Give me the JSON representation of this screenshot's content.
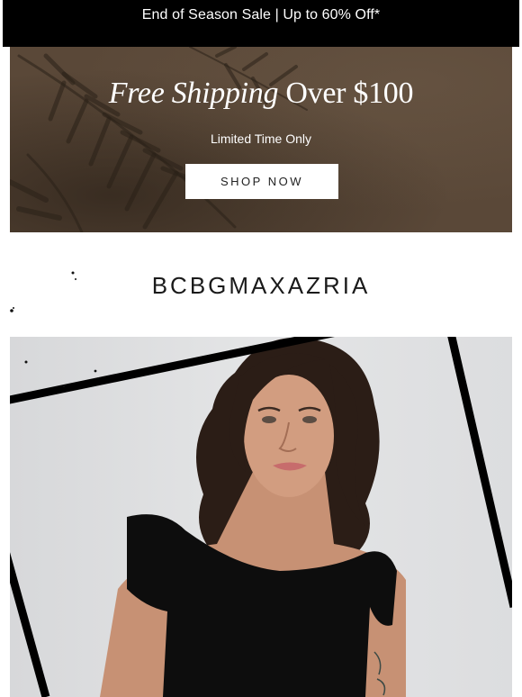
{
  "promo_bar": {
    "text": "End of Season Sale | Up to 60% Off*"
  },
  "shipping_banner": {
    "title_italic": "Free Shipping",
    "title_regular": "Over $100",
    "subtitle": "Limited Time Only",
    "button_label": "SHOP NOW",
    "background_color": "#5a4838"
  },
  "brand": {
    "name": "BCBGMAXAZRIA"
  },
  "hero": {
    "background_color": "#dedfe0",
    "garment_color": "#0d0d0d",
    "frame_color": "#000000"
  }
}
